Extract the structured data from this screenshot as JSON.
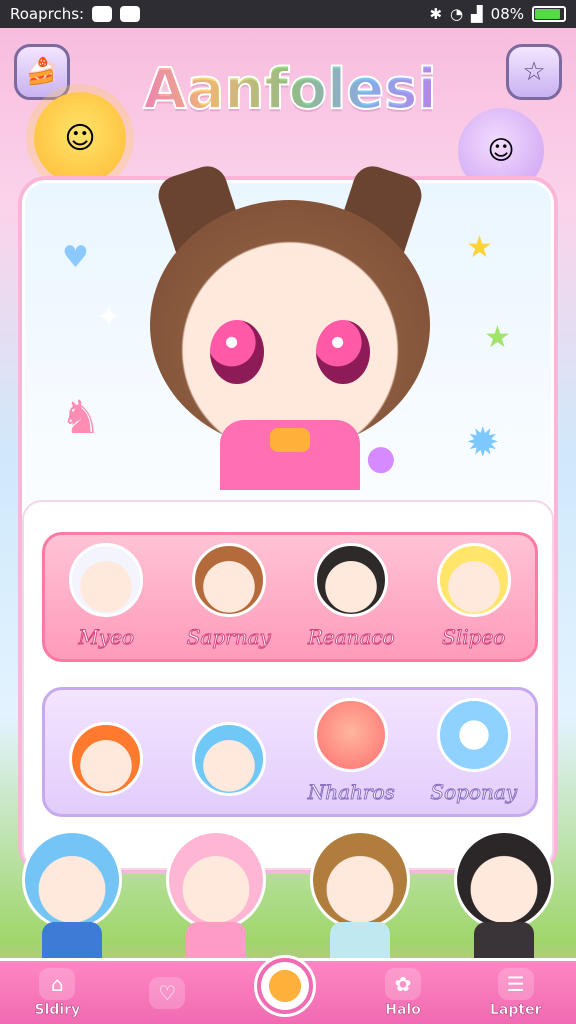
{
  "status_bar": {
    "left_text": "Roaprchs:",
    "battery_text": "08%"
  },
  "header": {
    "title": "Aanfolesi"
  },
  "roster": {
    "row1": [
      "Myeo",
      "Saprnay",
      "Reanaco",
      "Slipeo"
    ],
    "row2": [
      "",
      "",
      "Nhahros",
      "Soponay"
    ]
  },
  "colors": {
    "accent_pink": "#f06bb2",
    "row1_bg": "#ff9bbb",
    "row2_bg": "#e2cdfb"
  },
  "icons": {
    "top_left": "cake-icon",
    "top_right": "star-icon",
    "nav": [
      "home-icon",
      "heart-ring-icon",
      "orb-icon",
      "flower-icon",
      "menu-icon"
    ]
  },
  "bottom_nav": {
    "items": [
      {
        "label": "Sldiry"
      },
      {
        "label": ""
      },
      {
        "label": ""
      },
      {
        "label": "Halo"
      },
      {
        "label": "Lapter"
      }
    ]
  }
}
